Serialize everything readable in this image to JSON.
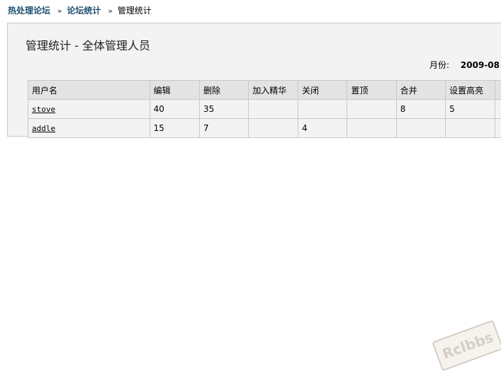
{
  "breadcrumb": {
    "forum": "热处理论坛",
    "stats": "论坛统计",
    "current": "管理统计",
    "separator": "»"
  },
  "panel": {
    "title": "管理统计 - 全体管理人员",
    "month_label": "月份:",
    "month_value": "2009-08"
  },
  "table": {
    "headers": [
      "用户名",
      "编辑",
      "删除",
      "加入精华",
      "关闭",
      "置顶",
      "合并",
      "设置高亮"
    ],
    "rows": [
      {
        "user": "stove",
        "cells": [
          "40",
          "35",
          "",
          "",
          "",
          "8",
          "5"
        ]
      },
      {
        "user": "addle",
        "cells": [
          "15",
          "7",
          "",
          "4",
          "",
          "",
          ""
        ]
      }
    ]
  },
  "watermark": "Rclbbs"
}
